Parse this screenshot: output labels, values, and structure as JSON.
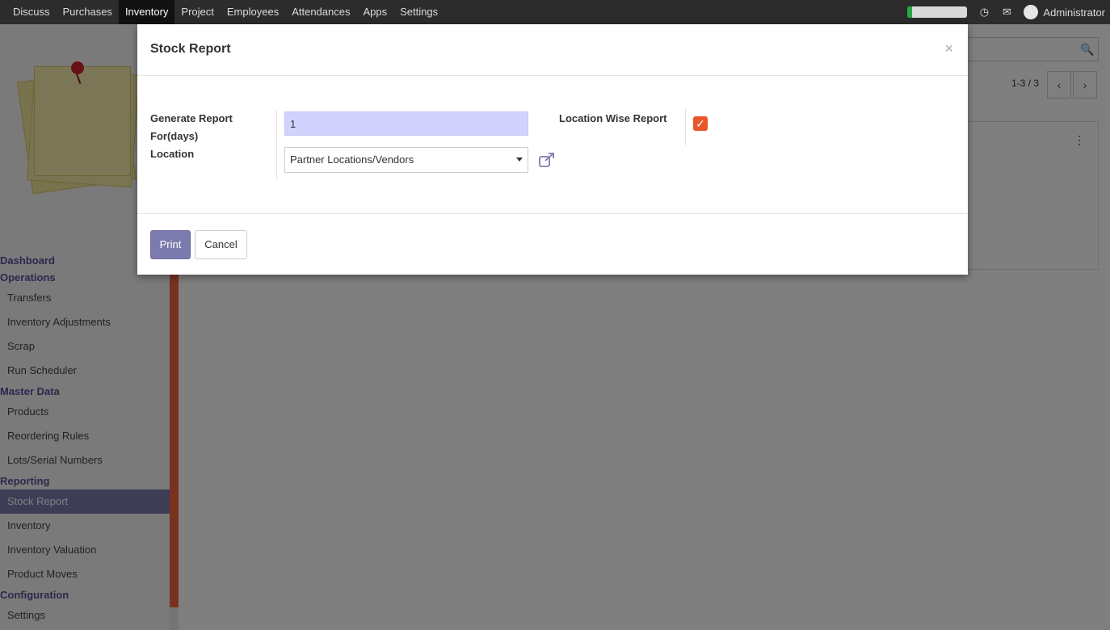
{
  "topbar": {
    "menu": [
      "Discuss",
      "Purchases",
      "Inventory",
      "Project",
      "Employees",
      "Attendances",
      "Apps",
      "Settings"
    ],
    "active_index": 2,
    "progress_fraction": 0.08,
    "progress_color": "#28a745",
    "icons": [
      "clock-icon",
      "chat-icon"
    ],
    "user": "Administrator"
  },
  "sidebar": {
    "sections": [
      {
        "title": "Dashboard",
        "items": []
      },
      {
        "title": "Operations",
        "items": [
          "Transfers",
          "Inventory Adjustments",
          "Scrap",
          "Run Scheduler"
        ]
      },
      {
        "title": "Master Data",
        "items": [
          "Products",
          "Reordering Rules",
          "Lots/Serial Numbers"
        ]
      },
      {
        "title": "Reporting",
        "items": [
          "Stock Report",
          "Inventory",
          "Inventory Valuation",
          "Product Moves"
        ]
      },
      {
        "title": "Configuration",
        "items": [
          "Settings"
        ]
      }
    ],
    "active_item": "Stock Report"
  },
  "main": {
    "pager": "1-3 / 3"
  },
  "modal": {
    "title": "Stock Report",
    "close": "×",
    "fields": {
      "days_label": "Generate Report For(days)",
      "days_value": "1",
      "location_label": "Location",
      "location_value": "Partner Locations/Vendors",
      "location_wise_label": "Location Wise Report",
      "location_wise_checked": true
    },
    "buttons": {
      "print": "Print",
      "cancel": "Cancel"
    }
  },
  "colors": {
    "accent": "#7c7bad",
    "checkbox": "#e8562a",
    "sidebar_scroll": "#f0653a"
  }
}
